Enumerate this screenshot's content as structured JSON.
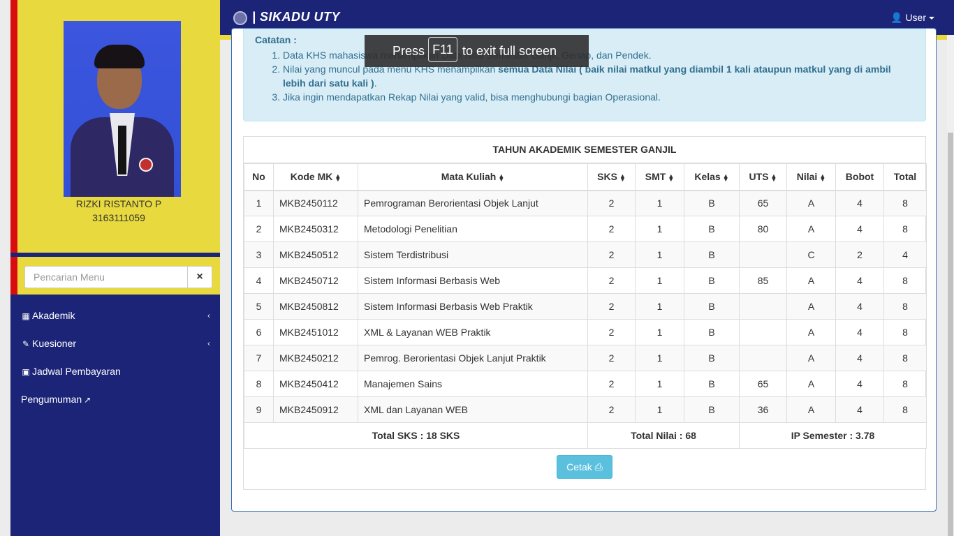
{
  "app": {
    "brand": "| SIKADU UTY"
  },
  "user_menu": {
    "label": "User"
  },
  "profile": {
    "name": "RIZKI RISTANTO P",
    "nim": "3163111059"
  },
  "search": {
    "placeholder": "Pencarian Menu",
    "clear_icon": "×"
  },
  "sidebar": {
    "items": [
      {
        "label": "Akademik",
        "icon": "building-icon",
        "glyph": "▦",
        "has_children": true
      },
      {
        "label": "Kuesioner",
        "icon": "check-square-icon",
        "glyph": "✎",
        "has_children": true
      },
      {
        "label": "Jadwal Pembayaran",
        "icon": "money-icon",
        "glyph": "▣",
        "has_children": false
      },
      {
        "label": "Pengumuman",
        "icon": "external-link-icon",
        "glyph": "",
        "has_children": false
      }
    ]
  },
  "notes": {
    "title": "Catatan :",
    "items": [
      {
        "pre": "Data KHS mahasiswa menampilkan",
        "bold": "",
        "post": "Data Nilai Semester Ganjil, Genap, dan Pendek."
      },
      {
        "pre": "Nilai yang muncul pada menu KHS menampilkan ",
        "bold": "semua Data Nilai ( baik nilai matkul yang diambil 1 kali ataupun matkul yang di ambil lebih dari satu kali )",
        "post": "."
      },
      {
        "pre": "Jika ingin mendapatkan Rekap Nilai yang valid, bisa menghubungi bagian Operasional.",
        "bold": "",
        "post": ""
      }
    ]
  },
  "khs": {
    "caption": "TAHUN AKADEMIK SEMESTER GANJIL",
    "columns": [
      "No",
      "Kode MK",
      "Mata Kuliah",
      "SKS",
      "SMT",
      "Kelas",
      "UTS",
      "Nilai",
      "Bobot",
      "Total"
    ],
    "rows": [
      [
        "1",
        "MKB2450112",
        "Pemrograman Berorientasi Objek Lanjut",
        "2",
        "1",
        "B",
        "65",
        "A",
        "4",
        "8"
      ],
      [
        "2",
        "MKB2450312",
        "Metodologi Penelitian",
        "2",
        "1",
        "B",
        "80",
        "A",
        "4",
        "8"
      ],
      [
        "3",
        "MKB2450512",
        "Sistem Terdistribusi",
        "2",
        "1",
        "B",
        "",
        "C",
        "2",
        "4"
      ],
      [
        "4",
        "MKB2450712",
        "Sistem Informasi Berbasis Web",
        "2",
        "1",
        "B",
        "85",
        "A",
        "4",
        "8"
      ],
      [
        "5",
        "MKB2450812",
        "Sistem Informasi Berbasis Web Praktik",
        "2",
        "1",
        "B",
        "",
        "A",
        "4",
        "8"
      ],
      [
        "6",
        "MKB2451012",
        "XML & Layanan WEB Praktik",
        "2",
        "1",
        "B",
        "",
        "A",
        "4",
        "8"
      ],
      [
        "7",
        "MKB2450212",
        "Pemrog. Berorientasi Objek Lanjut Praktik",
        "2",
        "1",
        "B",
        "",
        "A",
        "4",
        "8"
      ],
      [
        "8",
        "MKB2450412",
        "Manajemen Sains",
        "2",
        "1",
        "B",
        "65",
        "A",
        "4",
        "8"
      ],
      [
        "9",
        "MKB2450912",
        "XML dan Layanan WEB",
        "2",
        "1",
        "B",
        "36",
        "A",
        "4",
        "8"
      ]
    ],
    "total_sks": "Total SKS : 18 SKS",
    "total_nilai": "Total Nilai : 68",
    "ip_semester": "IP Semester : 3.78",
    "print_label": "Cetak"
  },
  "fullscreen_hint": {
    "pre": "Press",
    "key": "F11",
    "post": "to exit full screen"
  },
  "colors": {
    "navy": "#1c2478",
    "yellow": "#e8d93e",
    "red": "#d90d0d",
    "info": "#5bc0de"
  }
}
